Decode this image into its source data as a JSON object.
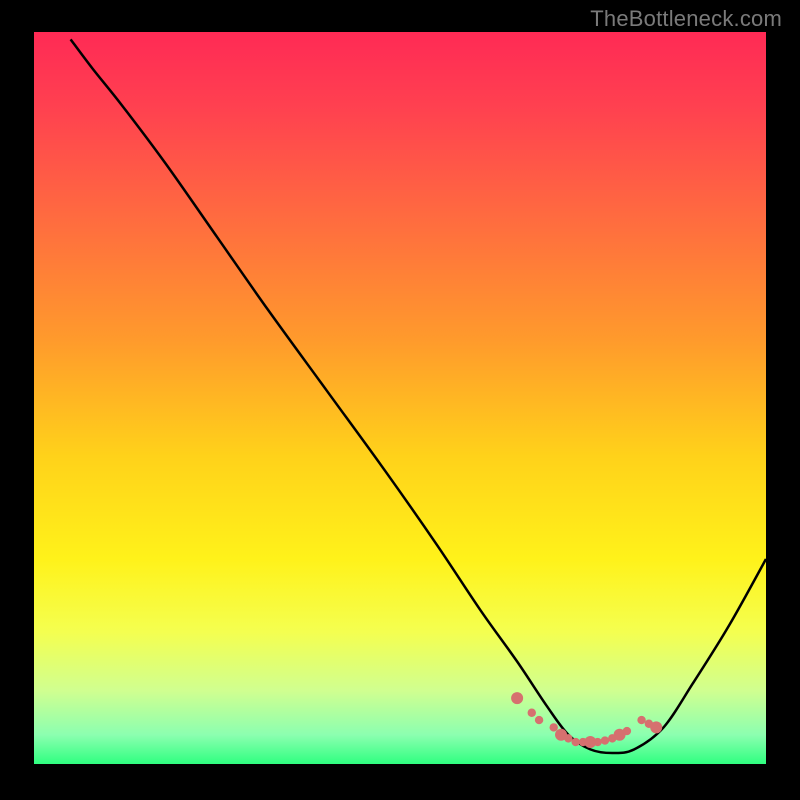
{
  "watermark": "TheBottleneck.com",
  "chart_data": {
    "type": "line",
    "title": "",
    "xlabel": "",
    "ylabel": "",
    "xlim": [
      0,
      100
    ],
    "ylim": [
      0,
      100
    ],
    "series": [
      {
        "name": "bottleneck-curve",
        "x": [
          5,
          8,
          12,
          18,
          25,
          32,
          40,
          48,
          55,
          61,
          66,
          70,
          73,
          76,
          79,
          82,
          86,
          90,
          95,
          100
        ],
        "y": [
          99,
          95,
          90,
          82,
          72,
          62,
          51,
          40,
          30,
          21,
          14,
          8,
          4,
          2,
          1.5,
          2,
          5,
          11,
          19,
          28
        ]
      }
    ],
    "markers": {
      "name": "highlight-points",
      "color": "#d6706f",
      "x": [
        66,
        68,
        69,
        71,
        72,
        73,
        74,
        75,
        76,
        77,
        78,
        79,
        80,
        81,
        83,
        84,
        85
      ],
      "y": [
        9,
        7,
        6,
        5,
        4,
        3.5,
        3,
        3,
        3,
        3,
        3.2,
        3.5,
        4,
        4.5,
        6,
        5.5,
        5
      ]
    },
    "gradient": {
      "stops": [
        {
          "offset": 0,
          "color": "#ff2a55"
        },
        {
          "offset": 0.1,
          "color": "#ff4050"
        },
        {
          "offset": 0.25,
          "color": "#ff6a40"
        },
        {
          "offset": 0.42,
          "color": "#ff9a2c"
        },
        {
          "offset": 0.58,
          "color": "#ffd21a"
        },
        {
          "offset": 0.72,
          "color": "#fff21a"
        },
        {
          "offset": 0.82,
          "color": "#f4ff50"
        },
        {
          "offset": 0.9,
          "color": "#d0ff90"
        },
        {
          "offset": 0.96,
          "color": "#8cffb0"
        },
        {
          "offset": 1,
          "color": "#2fff80"
        }
      ]
    }
  }
}
